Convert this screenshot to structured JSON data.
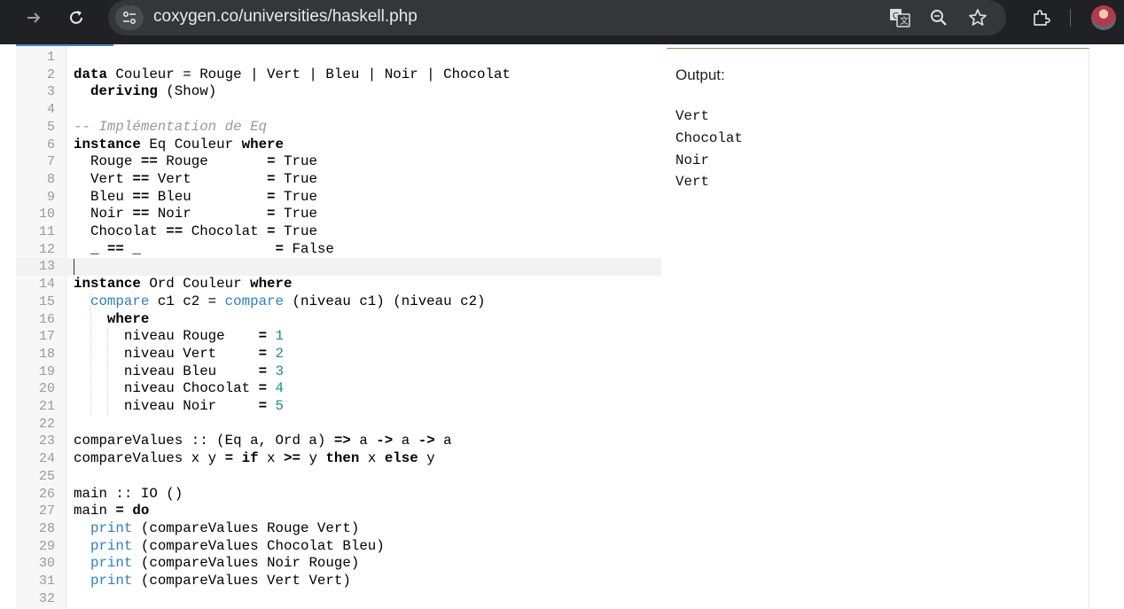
{
  "browser": {
    "url": "coxygen.co/universities/haskell.php"
  },
  "editor": {
    "lines": [
      {
        "n": "1",
        "tokens": [
          {
            "t": ""
          }
        ]
      },
      {
        "n": "2",
        "tokens": [
          {
            "t": "data",
            "c": "kw"
          },
          {
            "t": " Couleur = Rouge | Vert | Bleu | Noir | Chocolat"
          }
        ]
      },
      {
        "n": "3",
        "tokens": [
          {
            "t": "  "
          },
          {
            "t": "deriving",
            "c": "kw"
          },
          {
            "t": " (Show)"
          }
        ]
      },
      {
        "n": "4",
        "tokens": [
          {
            "t": ""
          }
        ]
      },
      {
        "n": "5",
        "tokens": [
          {
            "t": "-- Implémentation de Eq",
            "c": "cm"
          }
        ]
      },
      {
        "n": "6",
        "tokens": [
          {
            "t": "instance",
            "c": "kw"
          },
          {
            "t": " Eq Couleur "
          },
          {
            "t": "where",
            "c": "kw"
          }
        ]
      },
      {
        "n": "7",
        "tokens": [
          {
            "t": "  Rouge "
          },
          {
            "t": "==",
            "c": "kw"
          },
          {
            "t": " Rouge       "
          },
          {
            "t": "=",
            "c": "kw"
          },
          {
            "t": " True"
          }
        ]
      },
      {
        "n": "8",
        "tokens": [
          {
            "t": "  Vert "
          },
          {
            "t": "==",
            "c": "kw"
          },
          {
            "t": " Vert         "
          },
          {
            "t": "=",
            "c": "kw"
          },
          {
            "t": " True"
          }
        ]
      },
      {
        "n": "9",
        "tokens": [
          {
            "t": "  Bleu "
          },
          {
            "t": "==",
            "c": "kw"
          },
          {
            "t": " Bleu         "
          },
          {
            "t": "=",
            "c": "kw"
          },
          {
            "t": " True"
          }
        ]
      },
      {
        "n": "10",
        "tokens": [
          {
            "t": "  Noir "
          },
          {
            "t": "==",
            "c": "kw"
          },
          {
            "t": " Noir         "
          },
          {
            "t": "=",
            "c": "kw"
          },
          {
            "t": " True"
          }
        ]
      },
      {
        "n": "11",
        "tokens": [
          {
            "t": "  Chocolat "
          },
          {
            "t": "==",
            "c": "kw"
          },
          {
            "t": " Chocolat "
          },
          {
            "t": "=",
            "c": "kw"
          },
          {
            "t": " True"
          }
        ]
      },
      {
        "n": "12",
        "tokens": [
          {
            "t": "  _ "
          },
          {
            "t": "==",
            "c": "kw"
          },
          {
            "t": " _                "
          },
          {
            "t": "=",
            "c": "kw"
          },
          {
            "t": " False"
          }
        ]
      },
      {
        "n": "13",
        "tokens": [
          {
            "t": ""
          }
        ],
        "active": true
      },
      {
        "n": "14",
        "tokens": [
          {
            "t": "instance",
            "c": "kw"
          },
          {
            "t": " Ord Couleur "
          },
          {
            "t": "where",
            "c": "kw"
          }
        ]
      },
      {
        "n": "15",
        "tokens": [
          {
            "t": "  "
          },
          {
            "t": "compare",
            "c": "fn"
          },
          {
            "t": " c1 c2 = "
          },
          {
            "t": "compare",
            "c": "fn"
          },
          {
            "t": " (niveau c1) (niveau c2)"
          }
        ]
      },
      {
        "n": "16",
        "tokens": [
          {
            "t": "    "
          },
          {
            "t": "where",
            "c": "kw"
          }
        ]
      },
      {
        "n": "17",
        "tokens": [
          {
            "t": "      niveau Rouge    "
          },
          {
            "t": "=",
            "c": "kw"
          },
          {
            "t": " "
          },
          {
            "t": "1",
            "c": "num"
          }
        ]
      },
      {
        "n": "18",
        "tokens": [
          {
            "t": "      niveau Vert     "
          },
          {
            "t": "=",
            "c": "kw"
          },
          {
            "t": " "
          },
          {
            "t": "2",
            "c": "num"
          }
        ]
      },
      {
        "n": "19",
        "tokens": [
          {
            "t": "      niveau Bleu     "
          },
          {
            "t": "=",
            "c": "kw"
          },
          {
            "t": " "
          },
          {
            "t": "3",
            "c": "num"
          }
        ]
      },
      {
        "n": "20",
        "tokens": [
          {
            "t": "      niveau Chocolat "
          },
          {
            "t": "=",
            "c": "kw"
          },
          {
            "t": " "
          },
          {
            "t": "4",
            "c": "num"
          }
        ]
      },
      {
        "n": "21",
        "tokens": [
          {
            "t": "      niveau Noir     "
          },
          {
            "t": "=",
            "c": "kw"
          },
          {
            "t": " "
          },
          {
            "t": "5",
            "c": "num"
          }
        ]
      },
      {
        "n": "22",
        "tokens": [
          {
            "t": ""
          }
        ]
      },
      {
        "n": "23",
        "tokens": [
          {
            "t": "compareValues :: (Eq a, Ord a) "
          },
          {
            "t": "=>",
            "c": "kw"
          },
          {
            "t": " a "
          },
          {
            "t": "->",
            "c": "kw"
          },
          {
            "t": " a "
          },
          {
            "t": "->",
            "c": "kw"
          },
          {
            "t": " a"
          }
        ]
      },
      {
        "n": "24",
        "tokens": [
          {
            "t": "compareValues x y "
          },
          {
            "t": "=",
            "c": "kw"
          },
          {
            "t": " "
          },
          {
            "t": "if",
            "c": "kw"
          },
          {
            "t": " x "
          },
          {
            "t": ">=",
            "c": "kw"
          },
          {
            "t": " y "
          },
          {
            "t": "then",
            "c": "kw"
          },
          {
            "t": " x "
          },
          {
            "t": "else",
            "c": "kw"
          },
          {
            "t": " y"
          }
        ]
      },
      {
        "n": "25",
        "tokens": [
          {
            "t": ""
          }
        ]
      },
      {
        "n": "26",
        "tokens": [
          {
            "t": "main :: IO ()"
          }
        ]
      },
      {
        "n": "27",
        "tokens": [
          {
            "t": "main "
          },
          {
            "t": "=",
            "c": "kw"
          },
          {
            "t": " "
          },
          {
            "t": "do",
            "c": "kw"
          }
        ]
      },
      {
        "n": "28",
        "tokens": [
          {
            "t": "  "
          },
          {
            "t": "print",
            "c": "fn"
          },
          {
            "t": " (compareValues Rouge Vert)"
          }
        ]
      },
      {
        "n": "29",
        "tokens": [
          {
            "t": "  "
          },
          {
            "t": "print",
            "c": "fn"
          },
          {
            "t": " (compareValues Chocolat Bleu)"
          }
        ]
      },
      {
        "n": "30",
        "tokens": [
          {
            "t": "  "
          },
          {
            "t": "print",
            "c": "fn"
          },
          {
            "t": " (compareValues Noir Rouge)"
          }
        ]
      },
      {
        "n": "31",
        "tokens": [
          {
            "t": "  "
          },
          {
            "t": "print",
            "c": "fn"
          },
          {
            "t": " (compareValues Vert Vert)"
          }
        ]
      },
      {
        "n": "32",
        "tokens": [
          {
            "t": ""
          }
        ]
      }
    ]
  },
  "output": {
    "title": "Output:",
    "lines": [
      "Vert",
      "Chocolat",
      "Noir",
      "Vert"
    ]
  },
  "icons": {
    "forward": "forward-arrow-icon",
    "reload": "reload-icon",
    "site_info": "site-settings-icon",
    "translate": "translate-icon",
    "zoom": "zoom-icon",
    "bookmark": "bookmark-star-icon",
    "extensions": "extensions-icon",
    "profile": "profile-avatar"
  }
}
